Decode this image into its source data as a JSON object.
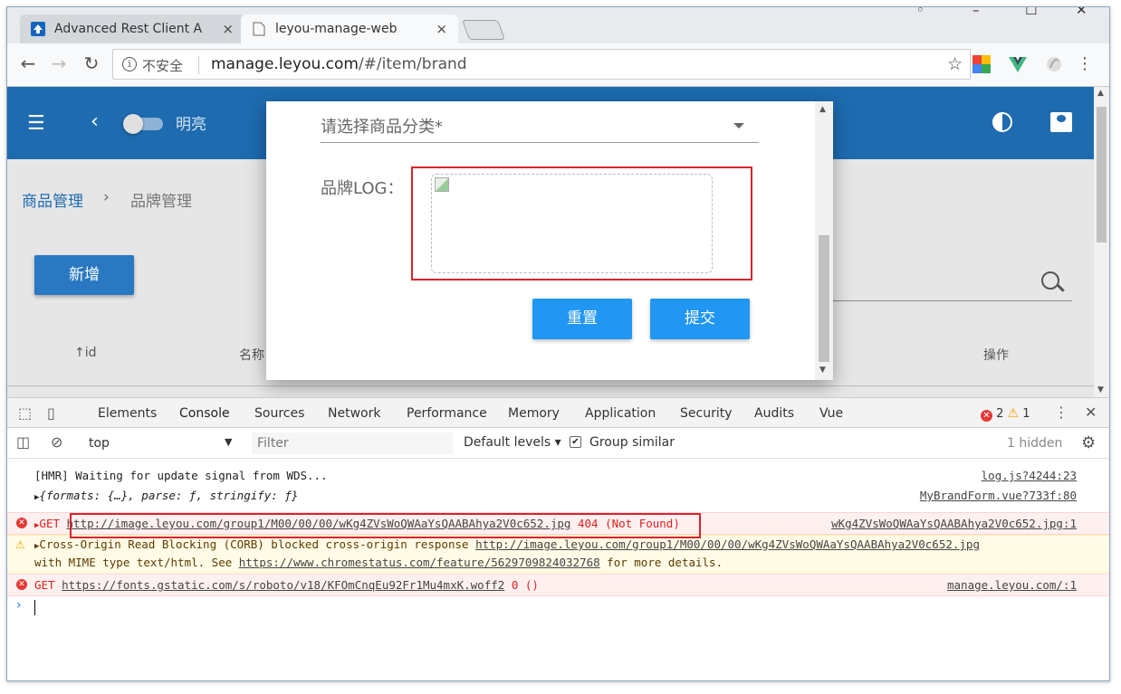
{
  "tabs": [
    {
      "title": "Advanced Rest Client A",
      "close": "×"
    },
    {
      "title": "leyou-manage-web",
      "close": "×"
    }
  ],
  "omnibox": {
    "security": "不安全",
    "url_host": "manage.leyou.com",
    "url_path": "/#/item/brand"
  },
  "app": {
    "mode_label": "明亮",
    "breadcrumb_root": "商品管理",
    "breadcrumb_sep": "›",
    "breadcrumb_current": "品牌管理",
    "add_button": "新增",
    "columns": [
      "id",
      "名称",
      "操作"
    ]
  },
  "dialog": {
    "category_placeholder": "请选择商品分类*",
    "logo_label": "品牌LOG：",
    "reset_button": "重置",
    "submit_button": "提交"
  },
  "devtools": {
    "tabs": [
      "Elements",
      "Console",
      "Sources",
      "Network",
      "Performance",
      "Memory",
      "Application",
      "Security",
      "Audits",
      "Vue"
    ],
    "active_tab": "Console",
    "error_count": "2",
    "warning_count": "1",
    "context": "top",
    "filter_placeholder": "Filter",
    "levels": "Default levels",
    "group_similar": "Group similar",
    "hidden": "1 hidden",
    "logs": [
      {
        "text": "[HMR] Waiting for update signal from WDS...",
        "src": "log.js?4244:23"
      },
      {
        "text": "{formats: {…}, parse: ƒ, stringify: ƒ}",
        "src": "MyBrandForm.vue?733f:80"
      },
      {
        "method": "GET",
        "url": "http://image.leyou.com/group1/M00/00/00/wKg4ZVsWoQWAaYsQAABAhya2V0c652.jpg",
        "status": "404 (Not Found)",
        "src": "wKg4ZVsWoQWAaYsQAABAhya2V0c652.jpg:1"
      },
      {
        "text": "Cross-Origin Read Blocking (CORB) blocked cross-origin response",
        "url": "http://image.leyou.com/group1/M00/00/00/wKg4ZVsWoQWAaYsQAABAhya2V0c652.jpg",
        "text2": "with MIME type text/html. See",
        "url2": "https://www.chromestatus.com/feature/5629709824032768",
        "text3": "for more details."
      },
      {
        "method": "GET",
        "url": "https://fonts.gstatic.com/s/roboto/v18/KFOmCnqEu92Fr1Mu4mxK.woff2",
        "status": "0 ()",
        "src": "manage.leyou.com/:1"
      }
    ]
  }
}
